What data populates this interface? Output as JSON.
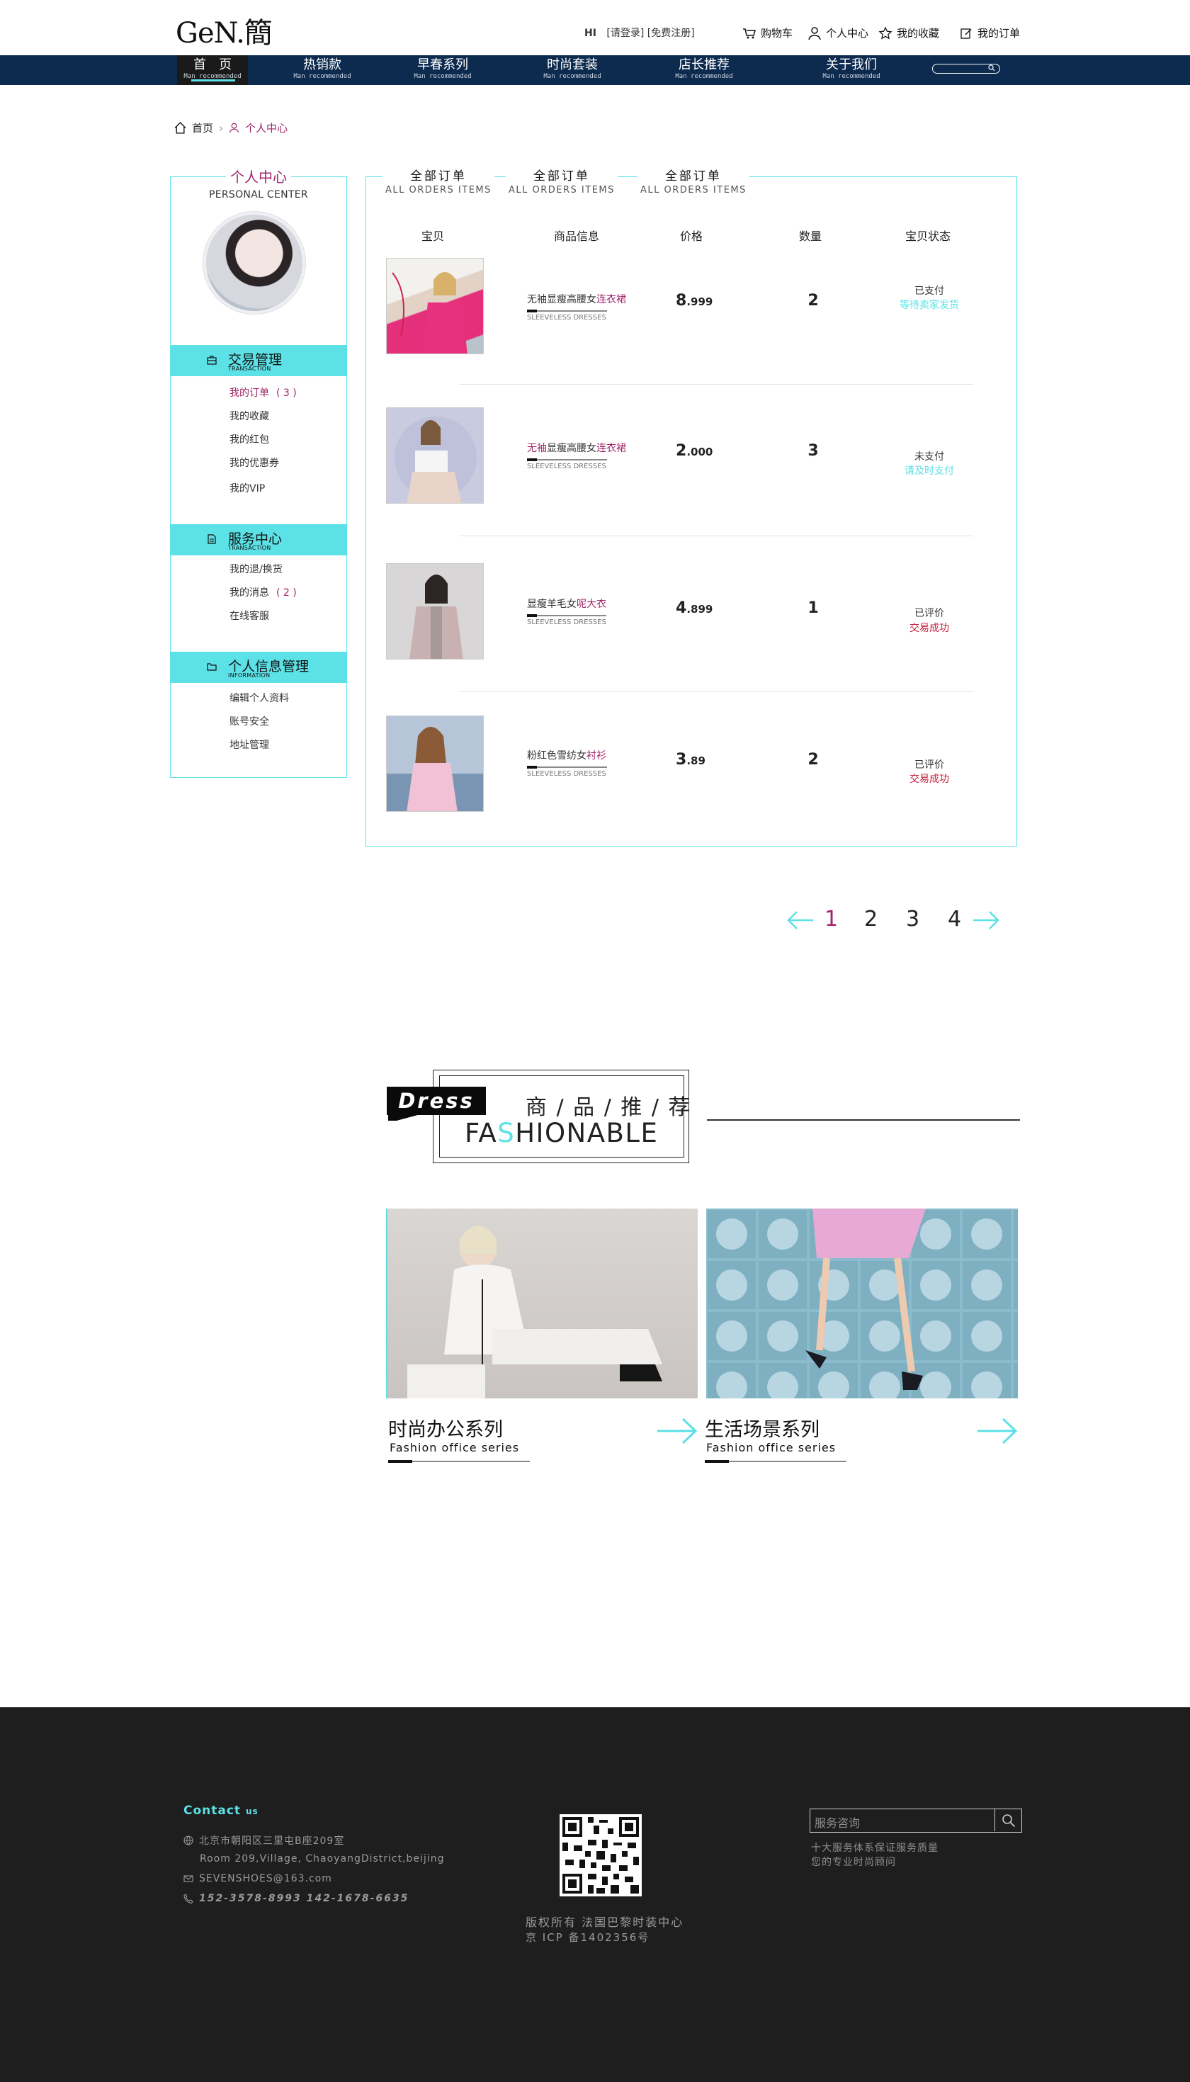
{
  "header": {
    "logo": "GeN.簡",
    "greeting": "HI",
    "login": "[请登录]",
    "register": "[免费注册]",
    "links": [
      "购物车",
      "个人中心",
      "我的收藏",
      "我的订单"
    ]
  },
  "nav": {
    "items": [
      {
        "label": "首　页",
        "sub": "Man recommended"
      },
      {
        "label": "热销款",
        "sub": "Man recommended"
      },
      {
        "label": "早春系列",
        "sub": "Man recommended"
      },
      {
        "label": "时尚套装",
        "sub": "Man recommended"
      },
      {
        "label": "店长推荐",
        "sub": "Man recommended"
      },
      {
        "label": "关于我们",
        "sub": "Man recommended"
      }
    ]
  },
  "breadcrumb": {
    "home": "首页",
    "current": "个人中心"
  },
  "sidebar": {
    "title": "个人中心",
    "title_en": "PERSONAL CENTER",
    "sections": [
      {
        "title": "交易管理",
        "title_en": "TRANSACTION",
        "items": [
          {
            "label": "我的订单",
            "count": "( 3 )"
          },
          {
            "label": "我的收藏"
          },
          {
            "label": "我的红包"
          },
          {
            "label": "我的优惠券"
          },
          {
            "label": "我的VIP"
          }
        ]
      },
      {
        "title": "服务中心",
        "title_en": "TRANSACTION",
        "items": [
          {
            "label": "我的退/换货"
          },
          {
            "label": "我的消息",
            "count": "( 2 )"
          },
          {
            "label": "在线客服"
          }
        ]
      },
      {
        "title": "个人信息管理",
        "title_en": "INFORMATION",
        "items": [
          {
            "label": "编辑个人资料"
          },
          {
            "label": "账号安全"
          },
          {
            "label": "地址管理"
          }
        ]
      }
    ]
  },
  "orders": {
    "tabs": [
      {
        "label": "全部订单",
        "en": "ALL  ORDERS  ITEMS"
      },
      {
        "label": "全部订单",
        "en": "ALL  ORDERS  ITEMS"
      },
      {
        "label": "全部订单",
        "en": "ALL  ORDERS  ITEMS"
      }
    ],
    "columns": [
      "宝贝",
      "商品信息",
      "价格",
      "数量",
      "宝贝状态"
    ],
    "rows": [
      {
        "name_a": "无袖显瘦高腰女",
        "name_b": "连衣裙",
        "name_en": "SLEEVELESS DRESSES",
        "price_int": "8",
        "price_dec": ".999",
        "qty": "2",
        "status": "已支付",
        "action": "等待卖家发货",
        "action_color": "#5ce1e6"
      },
      {
        "name_pre": "无袖",
        "name_a": "显瘦高腰女",
        "name_b": "连衣裙",
        "name_en": "SLEEVELESS DRESSES",
        "price_int": "2",
        "price_dec": ".000",
        "qty": "3",
        "status": "未支付",
        "action": "请及时支付",
        "action_color": "#5ce1e6"
      },
      {
        "name_a": "显瘦羊毛女",
        "name_b": "呢大衣",
        "name_en": "SLEEVELESS DRESSES",
        "price_int": "4",
        "price_dec": ".899",
        "qty": "1",
        "status": "已评价",
        "action": "交易成功",
        "action_color": "#c4203c"
      },
      {
        "name_a": "粉红色雪纺女",
        "name_b": "衬衫",
        "name_en": "SLEEVELESS DRESSES",
        "price_int": "3",
        "price_dec": ".89",
        "qty": "2",
        "status": "已评价",
        "action": "交易成功",
        "action_color": "#c4203c"
      }
    ]
  },
  "pagination": {
    "pages": [
      "1",
      "2",
      "3",
      "4"
    ],
    "current": "1"
  },
  "recommend": {
    "badge": "Dress",
    "title": "商 / 品 / 推 / 荐",
    "en_pre": "FA",
    "en_hl": "S",
    "en_post": "HIONABLE",
    "cards": [
      {
        "title": "时尚办公系列",
        "sub": "Fashion  office  series"
      },
      {
        "title": "生活场景系列",
        "sub": "Fashion  office  series"
      }
    ]
  },
  "footer": {
    "contact": "Contact",
    "contact_us": "us",
    "address_cn": "北京市朝阳区三里屯B座209室",
    "address_en": "Room  209,Village,  ChaoyangDistrict,beijing",
    "email": "SEVENSHOES@163.com",
    "phones": "152-3578-8993      142-1678-6635",
    "copyright": "版权所有  法国巴黎时装中心",
    "icp": "京 ICP 备1402356号",
    "search_placeholder": "服务咨询",
    "service1": "十大服务体系保证服务质量",
    "service2": "您的专业时尚顾问"
  },
  "colors": {
    "accent": "#5ce1e6",
    "magenta": "#a0246a",
    "nav": "#0d2a4f",
    "footer": "#1e1e1f"
  }
}
